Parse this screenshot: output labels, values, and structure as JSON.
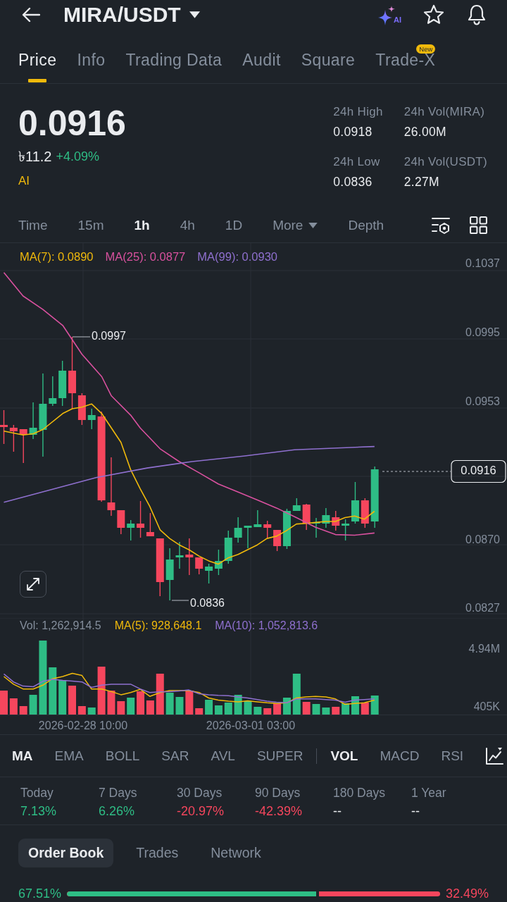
{
  "header": {
    "title": "MIRA/USDT",
    "ai_badge": "AI"
  },
  "tabs": [
    {
      "label": "Price",
      "selected": true
    },
    {
      "label": "Info",
      "selected": false
    },
    {
      "label": "Trading Data",
      "selected": false
    },
    {
      "label": "Audit",
      "selected": false
    },
    {
      "label": "Square",
      "selected": false
    },
    {
      "label": "Trade-X",
      "selected": false,
      "badge": "New"
    }
  ],
  "ticker": {
    "price": "0.0916",
    "fiat_price": "৳11.2",
    "change": "+4.09%",
    "ai_label": "AI",
    "stats": [
      {
        "label": "24h High",
        "value": "0.0918"
      },
      {
        "label": "24h Vol(MIRA)",
        "value": "26.00M"
      },
      {
        "label": "24h Low",
        "value": "0.0836"
      },
      {
        "label": "24h Vol(USDT)",
        "value": "2.27M"
      }
    ]
  },
  "intervals": [
    {
      "label": "Time",
      "kind": "option",
      "selected": false
    },
    {
      "label": "15m",
      "kind": "option",
      "selected": false
    },
    {
      "label": "1h",
      "kind": "option",
      "selected": true
    },
    {
      "label": "4h",
      "kind": "option",
      "selected": false
    },
    {
      "label": "1D",
      "kind": "option",
      "selected": false
    },
    {
      "label": "More",
      "kind": "dropdown",
      "selected": false
    },
    {
      "label": "Depth",
      "kind": "option",
      "selected": false
    }
  ],
  "chart": {
    "moving_averages": [
      {
        "label": "MA(7): 0.0890",
        "color": "#f0b90b"
      },
      {
        "label": "MA(25): 0.0877",
        "color": "#d9519f"
      },
      {
        "label": "MA(99): 0.0930",
        "color": "#8f70cf"
      }
    ],
    "y_axis_labels": [
      "0.1037",
      "0.0995",
      "0.0953",
      "0.0870",
      "0.0827"
    ],
    "last_price": "0.0916",
    "high_marker": "0.0997",
    "low_marker": "0.0836"
  },
  "volume": {
    "legend": [
      {
        "label": "Vol: 1,262,914.5",
        "color": "#848e9c"
      },
      {
        "label": "MA(5): 928,648.1",
        "color": "#f0b90b"
      },
      {
        "label": "MA(10): 1,052,813.6",
        "color": "#8f70cf"
      }
    ],
    "y_axis_labels": [
      "4.94M",
      "405K"
    ],
    "x_axis_labels": [
      "2026-02-28 10:00",
      "2026-03-01 03:00"
    ]
  },
  "indicators": {
    "main": [
      {
        "label": "MA",
        "selected": true
      },
      {
        "label": "EMA",
        "selected": false
      },
      {
        "label": "BOLL",
        "selected": false
      },
      {
        "label": "SAR",
        "selected": false
      },
      {
        "label": "AVL",
        "selected": false
      },
      {
        "label": "SUPER",
        "selected": false
      }
    ],
    "sub": [
      {
        "label": "VOL",
        "selected": true
      },
      {
        "label": "MACD",
        "selected": false
      },
      {
        "label": "RSI",
        "selected": false
      }
    ]
  },
  "performance": [
    {
      "period": "Today",
      "change": "7.13%",
      "color": "#2ebd85"
    },
    {
      "period": "7 Days",
      "change": "6.26%",
      "color": "#2ebd85"
    },
    {
      "period": "30 Days",
      "change": "-20.97%",
      "color": "#f6465d"
    },
    {
      "period": "90 Days",
      "change": "-42.39%",
      "color": "#f6465d"
    },
    {
      "period": "180 Days",
      "change": "--",
      "color": "#eaecef"
    },
    {
      "period": "1 Year",
      "change": "--",
      "color": "#eaecef"
    }
  ],
  "market_tabs": [
    {
      "label": "Order Book",
      "selected": true
    },
    {
      "label": "Trades",
      "selected": false
    },
    {
      "label": "Network",
      "selected": false
    }
  ],
  "order_book_ratio": {
    "buy_percent": "67.51%",
    "sell_percent": "32.49%",
    "level": 0.6751
  }
}
